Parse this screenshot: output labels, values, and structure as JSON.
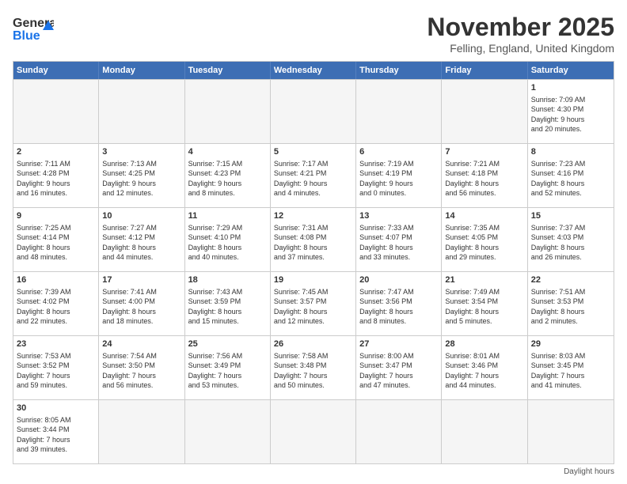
{
  "header": {
    "logo_general": "General",
    "logo_blue": "Blue",
    "title": "November 2025",
    "subtitle": "Felling, England, United Kingdom"
  },
  "weekdays": [
    "Sunday",
    "Monday",
    "Tuesday",
    "Wednesday",
    "Thursday",
    "Friday",
    "Saturday"
  ],
  "rows": [
    [
      {
        "day": "",
        "info": "",
        "empty": true
      },
      {
        "day": "",
        "info": "",
        "empty": true
      },
      {
        "day": "",
        "info": "",
        "empty": true
      },
      {
        "day": "",
        "info": "",
        "empty": true
      },
      {
        "day": "",
        "info": "",
        "empty": true
      },
      {
        "day": "",
        "info": "",
        "empty": true
      },
      {
        "day": "1",
        "info": "Sunrise: 7:09 AM\nSunset: 4:30 PM\nDaylight: 9 hours\nand 20 minutes."
      }
    ],
    [
      {
        "day": "2",
        "info": "Sunrise: 7:11 AM\nSunset: 4:28 PM\nDaylight: 9 hours\nand 16 minutes."
      },
      {
        "day": "3",
        "info": "Sunrise: 7:13 AM\nSunset: 4:25 PM\nDaylight: 9 hours\nand 12 minutes."
      },
      {
        "day": "4",
        "info": "Sunrise: 7:15 AM\nSunset: 4:23 PM\nDaylight: 9 hours\nand 8 minutes."
      },
      {
        "day": "5",
        "info": "Sunrise: 7:17 AM\nSunset: 4:21 PM\nDaylight: 9 hours\nand 4 minutes."
      },
      {
        "day": "6",
        "info": "Sunrise: 7:19 AM\nSunset: 4:19 PM\nDaylight: 9 hours\nand 0 minutes."
      },
      {
        "day": "7",
        "info": "Sunrise: 7:21 AM\nSunset: 4:18 PM\nDaylight: 8 hours\nand 56 minutes."
      },
      {
        "day": "8",
        "info": "Sunrise: 7:23 AM\nSunset: 4:16 PM\nDaylight: 8 hours\nand 52 minutes."
      }
    ],
    [
      {
        "day": "9",
        "info": "Sunrise: 7:25 AM\nSunset: 4:14 PM\nDaylight: 8 hours\nand 48 minutes."
      },
      {
        "day": "10",
        "info": "Sunrise: 7:27 AM\nSunset: 4:12 PM\nDaylight: 8 hours\nand 44 minutes."
      },
      {
        "day": "11",
        "info": "Sunrise: 7:29 AM\nSunset: 4:10 PM\nDaylight: 8 hours\nand 40 minutes."
      },
      {
        "day": "12",
        "info": "Sunrise: 7:31 AM\nSunset: 4:08 PM\nDaylight: 8 hours\nand 37 minutes."
      },
      {
        "day": "13",
        "info": "Sunrise: 7:33 AM\nSunset: 4:07 PM\nDaylight: 8 hours\nand 33 minutes."
      },
      {
        "day": "14",
        "info": "Sunrise: 7:35 AM\nSunset: 4:05 PM\nDaylight: 8 hours\nand 29 minutes."
      },
      {
        "day": "15",
        "info": "Sunrise: 7:37 AM\nSunset: 4:03 PM\nDaylight: 8 hours\nand 26 minutes."
      }
    ],
    [
      {
        "day": "16",
        "info": "Sunrise: 7:39 AM\nSunset: 4:02 PM\nDaylight: 8 hours\nand 22 minutes."
      },
      {
        "day": "17",
        "info": "Sunrise: 7:41 AM\nSunset: 4:00 PM\nDaylight: 8 hours\nand 18 minutes."
      },
      {
        "day": "18",
        "info": "Sunrise: 7:43 AM\nSunset: 3:59 PM\nDaylight: 8 hours\nand 15 minutes."
      },
      {
        "day": "19",
        "info": "Sunrise: 7:45 AM\nSunset: 3:57 PM\nDaylight: 8 hours\nand 12 minutes."
      },
      {
        "day": "20",
        "info": "Sunrise: 7:47 AM\nSunset: 3:56 PM\nDaylight: 8 hours\nand 8 minutes."
      },
      {
        "day": "21",
        "info": "Sunrise: 7:49 AM\nSunset: 3:54 PM\nDaylight: 8 hours\nand 5 minutes."
      },
      {
        "day": "22",
        "info": "Sunrise: 7:51 AM\nSunset: 3:53 PM\nDaylight: 8 hours\nand 2 minutes."
      }
    ],
    [
      {
        "day": "23",
        "info": "Sunrise: 7:53 AM\nSunset: 3:52 PM\nDaylight: 7 hours\nand 59 minutes."
      },
      {
        "day": "24",
        "info": "Sunrise: 7:54 AM\nSunset: 3:50 PM\nDaylight: 7 hours\nand 56 minutes."
      },
      {
        "day": "25",
        "info": "Sunrise: 7:56 AM\nSunset: 3:49 PM\nDaylight: 7 hours\nand 53 minutes."
      },
      {
        "day": "26",
        "info": "Sunrise: 7:58 AM\nSunset: 3:48 PM\nDaylight: 7 hours\nand 50 minutes."
      },
      {
        "day": "27",
        "info": "Sunrise: 8:00 AM\nSunset: 3:47 PM\nDaylight: 7 hours\nand 47 minutes."
      },
      {
        "day": "28",
        "info": "Sunrise: 8:01 AM\nSunset: 3:46 PM\nDaylight: 7 hours\nand 44 minutes."
      },
      {
        "day": "29",
        "info": "Sunrise: 8:03 AM\nSunset: 3:45 PM\nDaylight: 7 hours\nand 41 minutes."
      }
    ],
    [
      {
        "day": "30",
        "info": "Sunrise: 8:05 AM\nSunset: 3:44 PM\nDaylight: 7 hours\nand 39 minutes."
      },
      {
        "day": "",
        "info": "",
        "empty": true
      },
      {
        "day": "",
        "info": "",
        "empty": true
      },
      {
        "day": "",
        "info": "",
        "empty": true
      },
      {
        "day": "",
        "info": "",
        "empty": true
      },
      {
        "day": "",
        "info": "",
        "empty": true
      },
      {
        "day": "",
        "info": "",
        "empty": true
      }
    ]
  ],
  "footer": {
    "note": "Daylight hours"
  }
}
